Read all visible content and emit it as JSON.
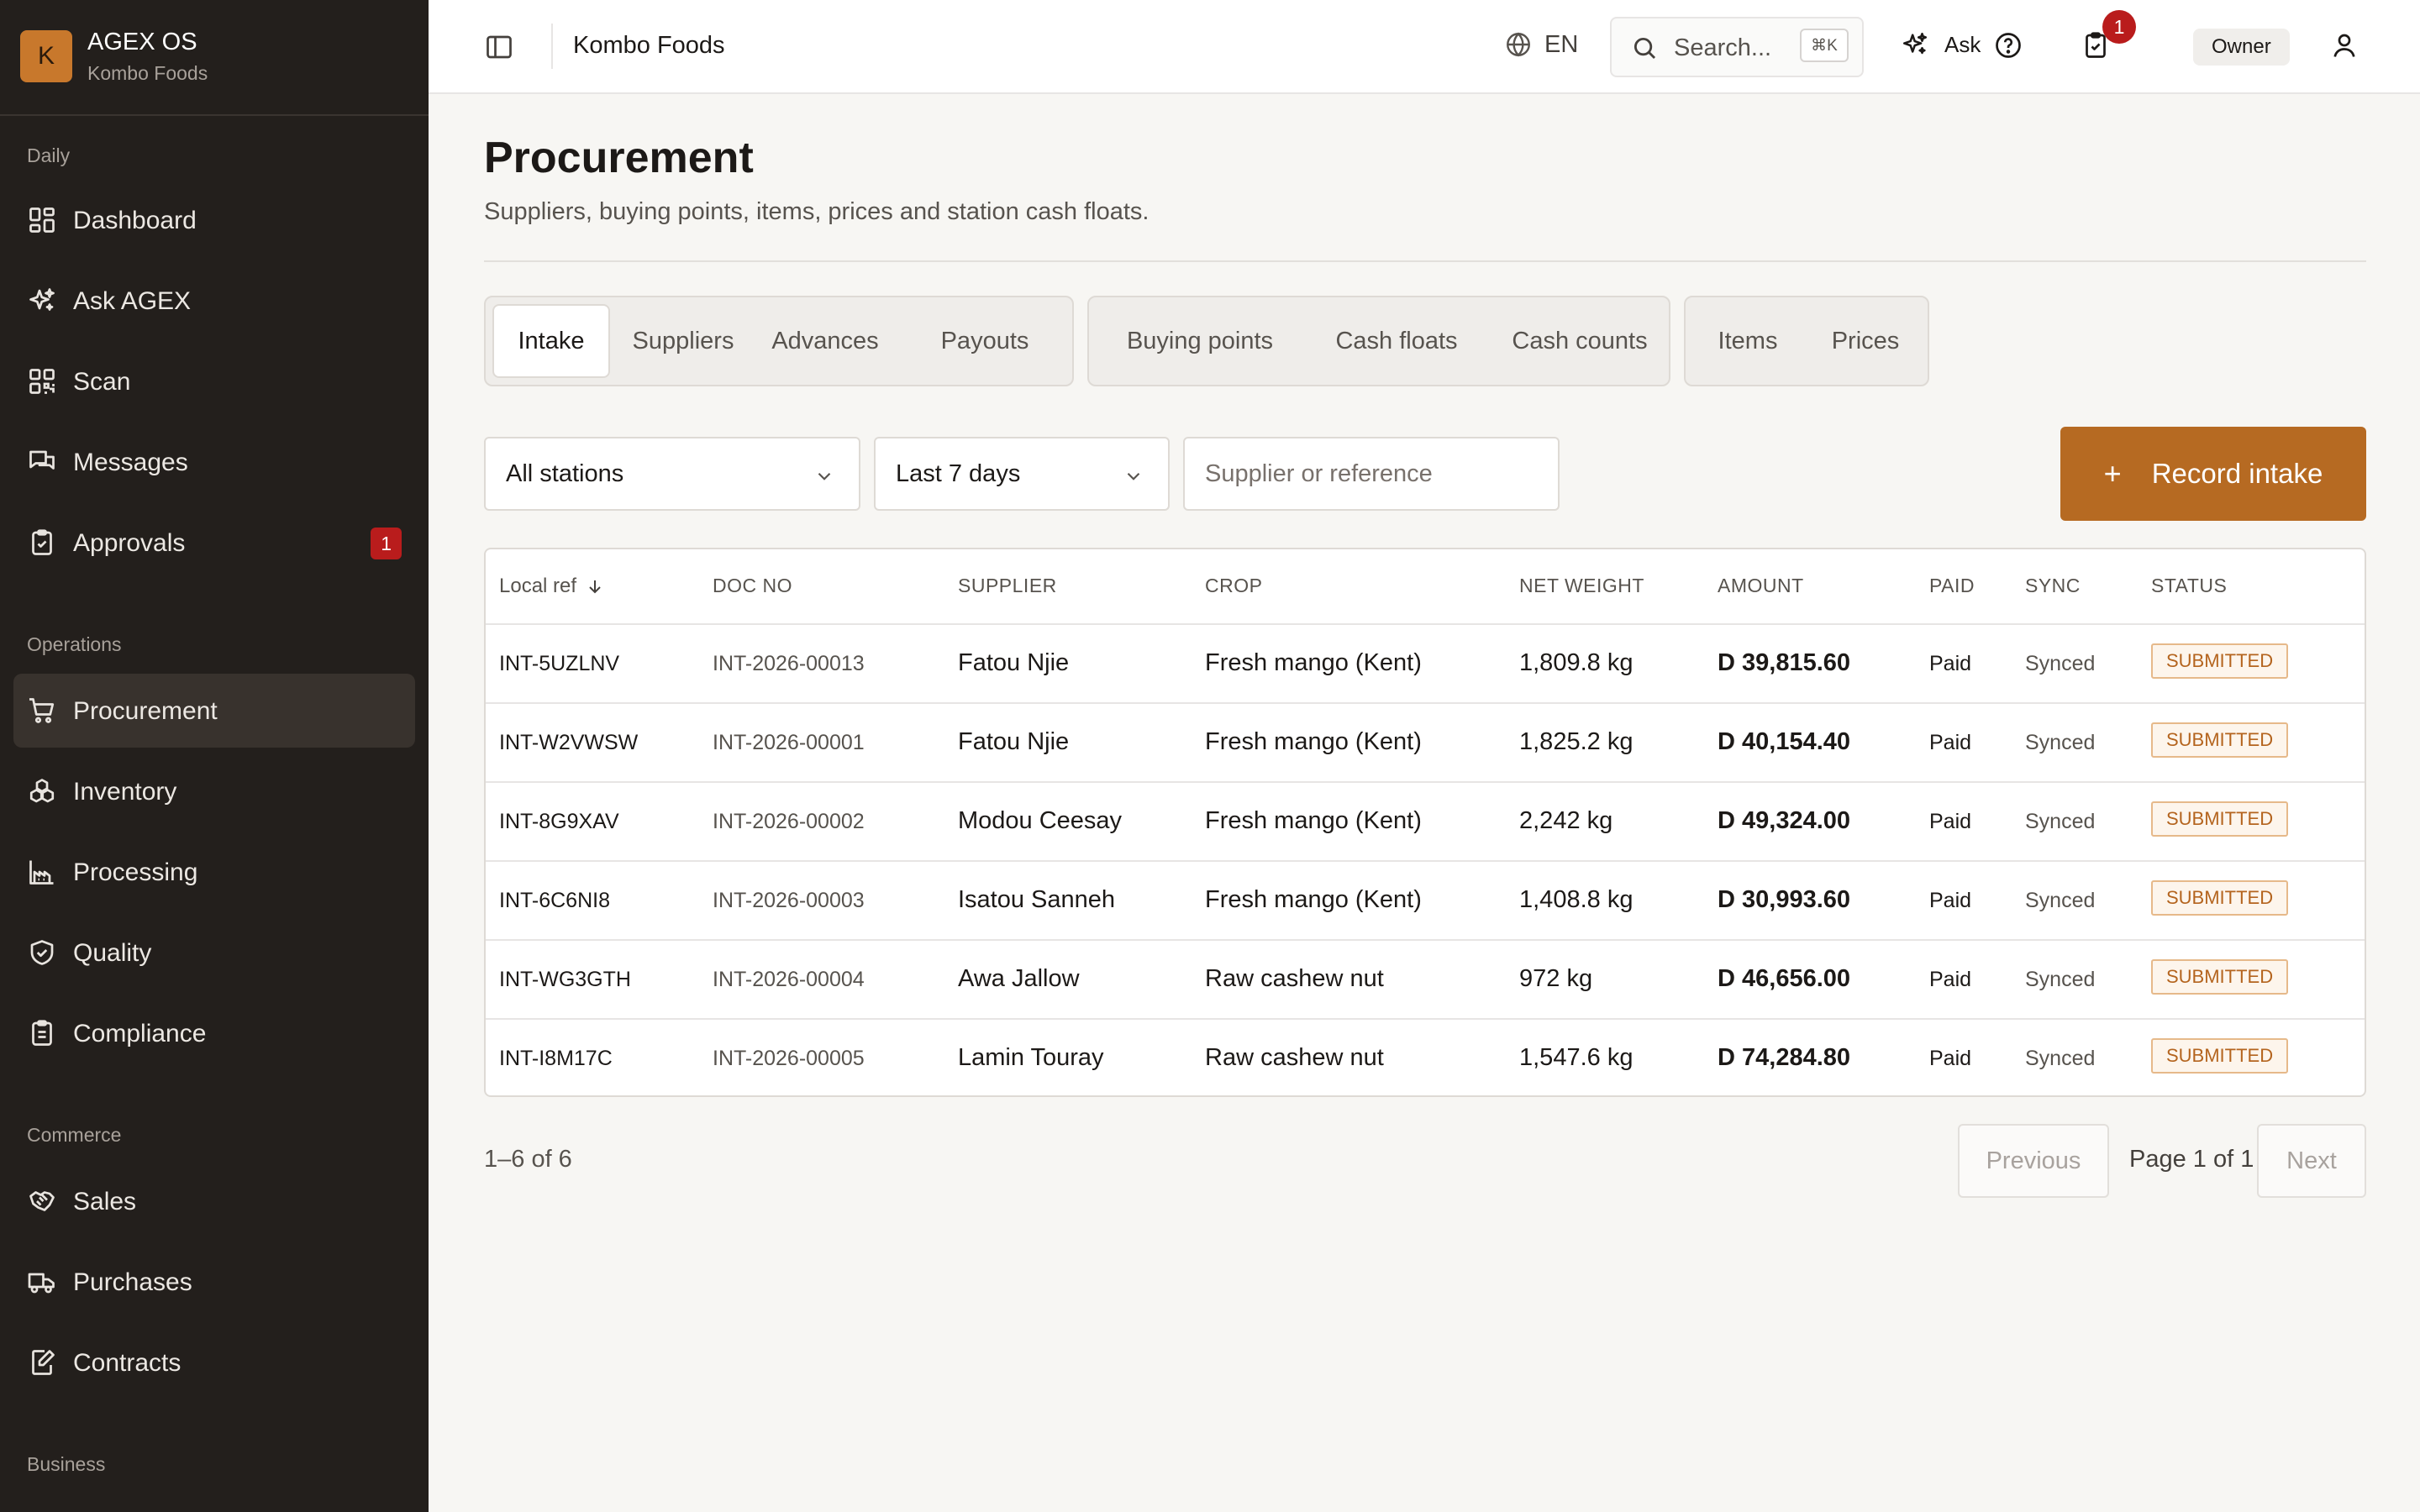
{
  "brand": {
    "logo_letter": "K",
    "name": "AGEX OS",
    "org": "Kombo Foods"
  },
  "sidebar": {
    "sections": [
      {
        "title": "Daily"
      },
      {
        "title": "Operations"
      },
      {
        "title": "Commerce"
      },
      {
        "title": "Business"
      }
    ],
    "items": [
      {
        "label": "Dashboard",
        "icon": "dashboard-icon"
      },
      {
        "label": "Ask AGEX",
        "icon": "sparkle-icon"
      },
      {
        "label": "Scan",
        "icon": "scan-icon"
      },
      {
        "label": "Messages",
        "icon": "messages-icon"
      },
      {
        "label": "Approvals",
        "icon": "clipboard-check-icon",
        "count": "1"
      },
      {
        "label": "Procurement",
        "icon": "cart-icon",
        "active": true
      },
      {
        "label": "Inventory",
        "icon": "boxes-icon"
      },
      {
        "label": "Processing",
        "icon": "factory-icon"
      },
      {
        "label": "Quality",
        "icon": "shield-check-icon"
      },
      {
        "label": "Compliance",
        "icon": "clipboard-list-icon"
      },
      {
        "label": "Sales",
        "icon": "handshake-icon"
      },
      {
        "label": "Purchases",
        "icon": "truck-icon"
      },
      {
        "label": "Contracts",
        "icon": "file-edit-icon"
      }
    ]
  },
  "topbar": {
    "org": "Kombo Foods",
    "lang": "EN",
    "search_placeholder": "Search...",
    "search_shortcut": "⌘K",
    "ask_label": "Ask",
    "approvals_badge": "1",
    "role": "Owner"
  },
  "page": {
    "title": "Procurement",
    "subtitle": "Suppliers, buying points, items, prices and station cash floats."
  },
  "tabs": {
    "group1": [
      "Intake",
      "Suppliers",
      "Advances",
      "Payouts"
    ],
    "group2": [
      "Buying points",
      "Cash floats",
      "Cash counts"
    ],
    "group3": [
      "Items",
      "Prices"
    ],
    "active": "Intake"
  },
  "filters": {
    "station": "All stations",
    "period": "Last 7 days",
    "search_placeholder": "Supplier or reference",
    "record_button": "Record intake"
  },
  "table": {
    "columns": {
      "local_ref": "Local ref",
      "doc_no": "DOC NO",
      "supplier": "SUPPLIER",
      "crop": "CROP",
      "net_weight": "NET WEIGHT",
      "amount": "AMOUNT",
      "paid": "PAID",
      "sync": "SYNC",
      "status": "STATUS"
    },
    "rows": [
      {
        "local_ref": "INT-5UZLNV",
        "doc_no": "INT-2026-00013",
        "supplier": "Fatou Njie",
        "crop": "Fresh mango (Kent)",
        "net_weight": "1,809.8 kg",
        "amount": "D 39,815.60",
        "paid": "Paid",
        "sync": "Synced",
        "status": "SUBMITTED"
      },
      {
        "local_ref": "INT-W2VWSW",
        "doc_no": "INT-2026-00001",
        "supplier": "Fatou Njie",
        "crop": "Fresh mango (Kent)",
        "net_weight": "1,825.2 kg",
        "amount": "D 40,154.40",
        "paid": "Paid",
        "sync": "Synced",
        "status": "SUBMITTED"
      },
      {
        "local_ref": "INT-8G9XAV",
        "doc_no": "INT-2026-00002",
        "supplier": "Modou Ceesay",
        "crop": "Fresh mango (Kent)",
        "net_weight": "2,242 kg",
        "amount": "D 49,324.00",
        "paid": "Paid",
        "sync": "Synced",
        "status": "SUBMITTED"
      },
      {
        "local_ref": "INT-6C6NI8",
        "doc_no": "INT-2026-00003",
        "supplier": "Isatou Sanneh",
        "crop": "Fresh mango (Kent)",
        "net_weight": "1,408.8 kg",
        "amount": "D 30,993.60",
        "paid": "Paid",
        "sync": "Synced",
        "status": "SUBMITTED"
      },
      {
        "local_ref": "INT-WG3GTH",
        "doc_no": "INT-2026-00004",
        "supplier": "Awa Jallow",
        "crop": "Raw cashew nut",
        "net_weight": "972 kg",
        "amount": "D 46,656.00",
        "paid": "Paid",
        "sync": "Synced",
        "status": "SUBMITTED"
      },
      {
        "local_ref": "INT-I8M17C",
        "doc_no": "INT-2026-00005",
        "supplier": "Lamin Touray",
        "crop": "Raw cashew nut",
        "net_weight": "1,547.6 kg",
        "amount": "D 74,284.80",
        "paid": "Paid",
        "sync": "Synced",
        "status": "SUBMITTED"
      }
    ]
  },
  "pagination": {
    "count": "1–6 of 6",
    "previous": "Previous",
    "page": "Page 1 of 1",
    "next": "Next"
  },
  "colors": {
    "sidebar_bg": "#231f1c",
    "accent": "#b66a22",
    "badge_red": "#b91c1c",
    "status_text": "#b4641e"
  }
}
